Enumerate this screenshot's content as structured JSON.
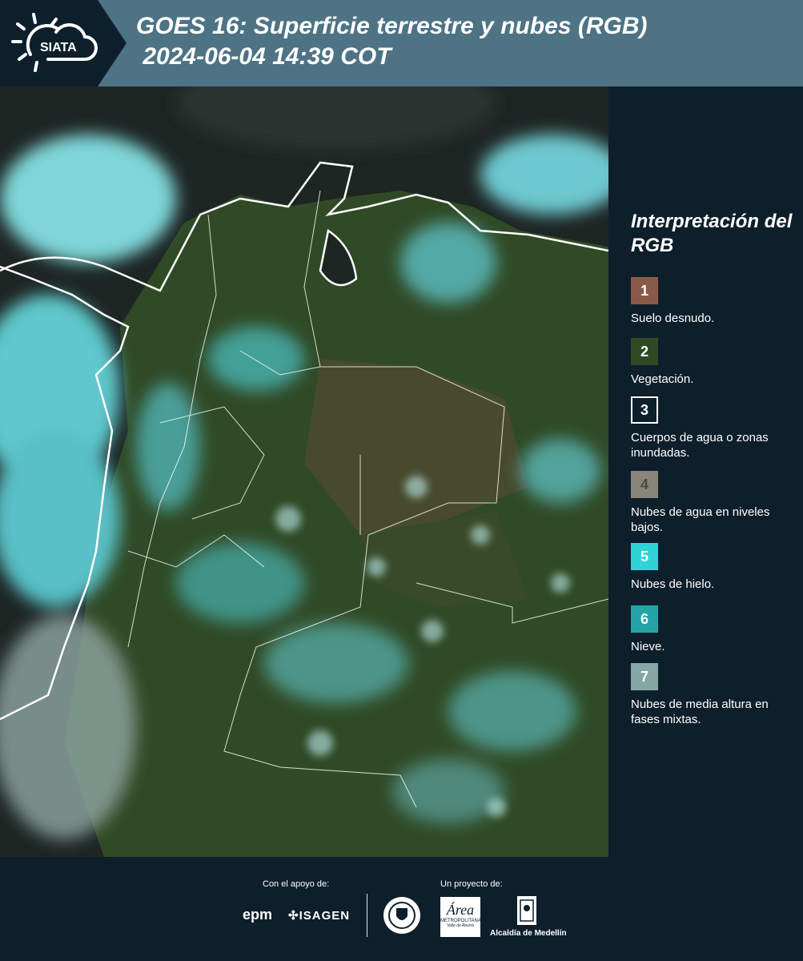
{
  "header": {
    "title": "GOES 16: Superficie terrestre y nubes (RGB)\n 2024-06-04 14:39 COT",
    "logo_text": "SIATA"
  },
  "legend": {
    "title": "Interpretación del RGB",
    "items": [
      {
        "number": "1",
        "label": "Suelo desnudo.",
        "color": "#8a5a48"
      },
      {
        "number": "2",
        "label": "Vegetación.",
        "color": "#2e4a22"
      },
      {
        "number": "3",
        "label": "Cuerpos de agua o zonas inundadas.",
        "color": "#0e1f2c"
      },
      {
        "number": "4",
        "label": "Nubes de agua en niveles bajos.",
        "color": "#8a857a"
      },
      {
        "number": "5",
        "label": "Nubes de hielo.",
        "color": "#2fd4d6"
      },
      {
        "number": "6",
        "label": "Nieve.",
        "color": "#25a4a6"
      },
      {
        "number": "7",
        "label": "Nubes de media altura en fases mixtas.",
        "color": "#84a7a6"
      }
    ]
  },
  "footer": {
    "support_label": "Con el apoyo de:",
    "project_label": "Un proyecto de:",
    "brands": [
      "epm",
      "ISAGEN",
      "Área Metropolitana Valle de Aburrá",
      "Alcaldía de Medellín"
    ],
    "epm_text": "epm",
    "isagen_text": "ISAGEN",
    "amva_text": "Área",
    "amva_sub": "METROPOLITANA",
    "amva_sub2": "Valle de Aburrá",
    "medellin_text": "Alcaldía de Medellín"
  },
  "colors": {
    "bg": "#0e1f2c",
    "header": "#4d7385"
  }
}
